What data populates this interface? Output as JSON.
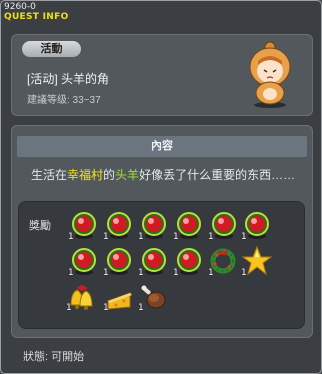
{
  "window": {
    "code": "9260-0",
    "title": "QUEST INFO"
  },
  "quest": {
    "category_badge": "活動",
    "name": "[活动] 头羊的角",
    "level_text": "建議等级: 33~37"
  },
  "content": {
    "section_title": "內容",
    "description": {
      "part1": "生活在",
      "place": "幸福村",
      "part2": "的",
      "npc": "头羊",
      "part3": "好像丢了什么重要的东西……"
    }
  },
  "rewards": {
    "label": "獎勵",
    "items": [
      {
        "icon": "red-orb-icon",
        "qty": "1"
      },
      {
        "icon": "red-orb-icon",
        "qty": "1"
      },
      {
        "icon": "red-orb-icon",
        "qty": "1"
      },
      {
        "icon": "red-orb-icon",
        "qty": "1"
      },
      {
        "icon": "red-orb-icon",
        "qty": "1"
      },
      {
        "icon": "red-orb-icon",
        "qty": "1"
      },
      {
        "icon": "red-orb-icon",
        "qty": "1"
      },
      {
        "icon": "red-orb-icon",
        "qty": "1"
      },
      {
        "icon": "red-orb-icon",
        "qty": "1"
      },
      {
        "icon": "red-orb-icon",
        "qty": "1"
      },
      {
        "icon": "wreath-icon",
        "qty": "1"
      },
      {
        "icon": "star-icon",
        "qty": "1"
      },
      {
        "icon": "bell-icon",
        "qty": "1"
      },
      {
        "icon": "cheese-icon",
        "qty": "1"
      },
      {
        "icon": "meat-leg-icon",
        "qty": "1"
      }
    ]
  },
  "status": {
    "text": "狀態: 可開始"
  },
  "colors": {
    "highlight_place": "#f5e41a",
    "highlight_npc": "#9ee234",
    "title": "#f0e010"
  }
}
